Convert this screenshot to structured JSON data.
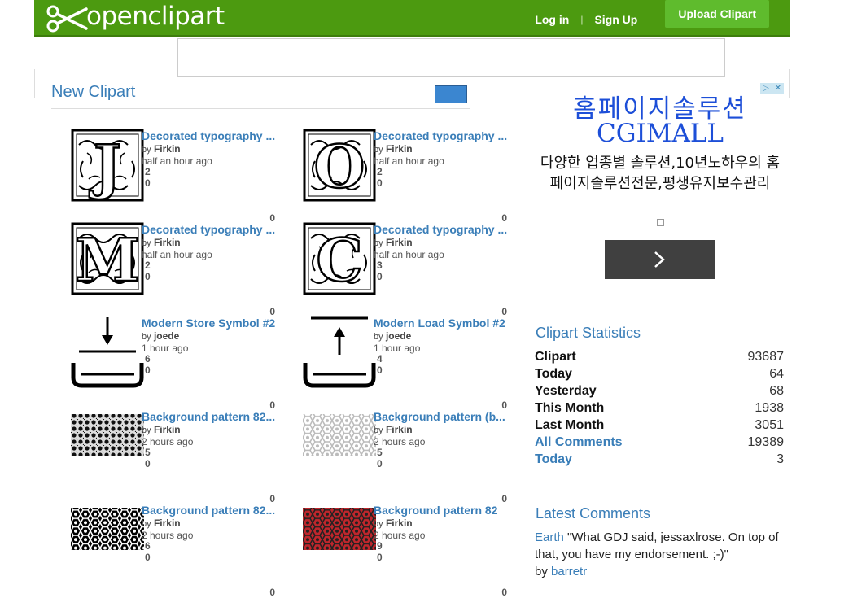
{
  "header": {
    "logo_text": "openclipart",
    "login": "Log in",
    "separator": "|",
    "signup": "Sign Up",
    "upload": "Upload Clipart"
  },
  "new_clipart": {
    "title": "New Clipart",
    "items": [
      {
        "title": "Decorated typography ...",
        "by_prefix": "by",
        "author": "Firkin",
        "time": "half an hour ago",
        "n1": "2",
        "n2": "0",
        "n3": "0",
        "thumb": "letter-J-icon",
        "letter": "J"
      },
      {
        "title": "Decorated typography ...",
        "by_prefix": "by",
        "author": "Firkin",
        "time": "half an hour ago",
        "n1": "2",
        "n2": "0",
        "n3": "0",
        "thumb": "letter-O-icon",
        "letter": "O"
      },
      {
        "title": "Decorated typography ...",
        "by_prefix": "by",
        "author": "Firkin",
        "time": "half an hour ago",
        "n1": "2",
        "n2": "0",
        "n3": "0",
        "thumb": "letter-M-icon",
        "letter": "M"
      },
      {
        "title": "Decorated typography ...",
        "by_prefix": "by",
        "author": "Firkin",
        "time": "half an hour ago",
        "n1": "3",
        "n2": "0",
        "n3": "0",
        "thumb": "letter-C-icon",
        "letter": "C"
      },
      {
        "title": "Modern Store Symbol #2",
        "by_prefix": "by",
        "author": "joede",
        "time": "1 hour ago",
        "n1": "6",
        "n2": "0",
        "n3": "0",
        "thumb": "store-symbol-icon"
      },
      {
        "title": "Modern Load Symbol #2",
        "by_prefix": "by",
        "author": "joede",
        "time": "1 hour ago",
        "n1": "4",
        "n2": "0",
        "n3": "0",
        "thumb": "load-symbol-icon"
      },
      {
        "title": "Background pattern 82...",
        "by_prefix": "by",
        "author": "Firkin",
        "time": "2 hours ago",
        "n1": "5",
        "n2": "0",
        "n3": "0",
        "thumb": "pattern-dots-icon"
      },
      {
        "title": "Background pattern (b...",
        "by_prefix": "by",
        "author": "Firkin",
        "time": "2 hours ago",
        "n1": "5",
        "n2": "0",
        "n3": "0",
        "thumb": "pattern-hex-light-icon"
      },
      {
        "title": "Background pattern 82...",
        "by_prefix": "by",
        "author": "Firkin",
        "time": "2 hours ago",
        "n1": "6",
        "n2": "0",
        "n3": "0",
        "thumb": "pattern-hex-dark-icon"
      },
      {
        "title": "Background pattern 82",
        "by_prefix": "by",
        "author": "Firkin",
        "time": "2 hours ago",
        "n1": "9",
        "n2": "0",
        "n3": "0",
        "thumb": "pattern-hex-red-icon"
      }
    ]
  },
  "ad": {
    "headline": "홈페이지솔루션",
    "brand": "CGIMALL",
    "description": "다양한 업종별 솔루션,10년노하우의 홈페이지솔루션전문,평생유지보수관리"
  },
  "statistics": {
    "title": "Clipart Statistics",
    "rows": [
      {
        "label": "Clipart",
        "value": "93687"
      },
      {
        "label": "Today",
        "value": "64"
      },
      {
        "label": "Yesterday",
        "value": "68"
      },
      {
        "label": "This Month",
        "value": "1938"
      },
      {
        "label": "Last Month",
        "value": "3051"
      },
      {
        "label": "All Comments",
        "value": "19389"
      },
      {
        "label": "Today",
        "value": "3"
      }
    ]
  },
  "latest_comments": {
    "title": "Latest Comments",
    "author": "Earth",
    "text": "\"What GDJ said, jessaxlrose. On top of that, you have my endorsement. ;-)\"",
    "by_prefix": "by",
    "by": "barretr"
  },
  "colors": {
    "header_green": "#4c9a10",
    "upload_green": "#5fbb2d",
    "link_blue": "#3a7eb8",
    "ad_blue": "#1d4fd8"
  }
}
